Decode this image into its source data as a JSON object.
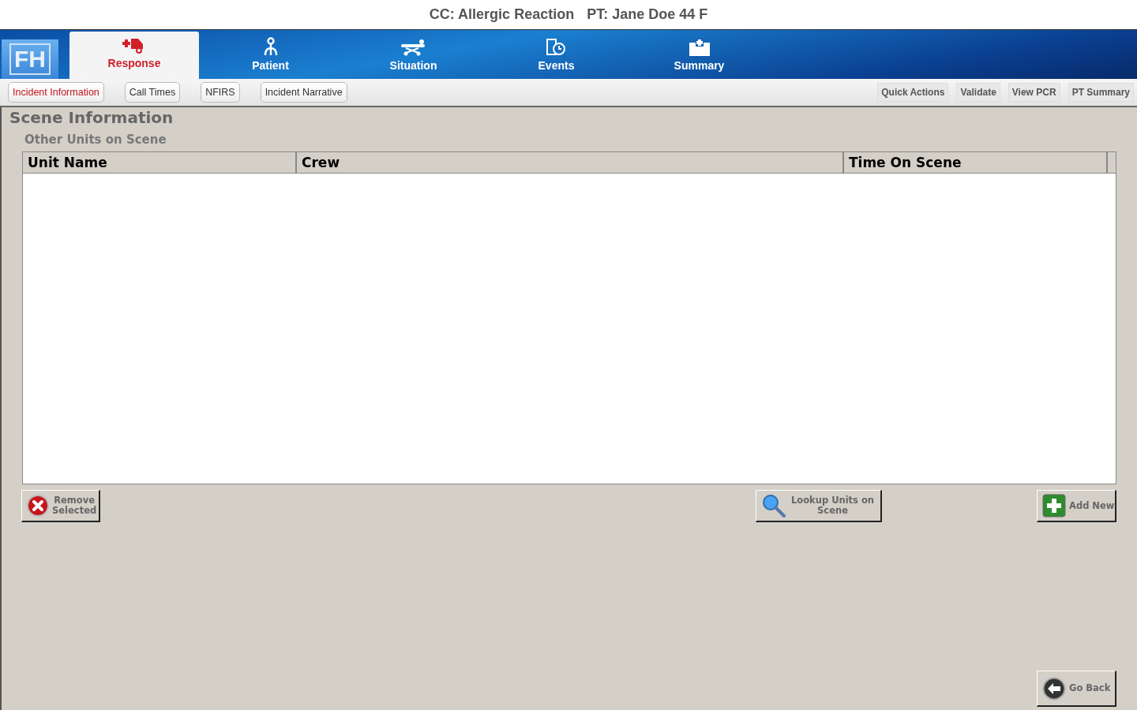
{
  "header": {
    "complaint": "CC: Allergic Reaction",
    "patient": "PT: Jane Doe 44 F"
  },
  "logo": "FH",
  "nav_tabs": [
    {
      "label": "Response",
      "kind": "ambulance",
      "selected": true
    },
    {
      "label": "Patient",
      "kind": "person",
      "selected": false
    },
    {
      "label": "Situation",
      "kind": "stretcher",
      "selected": false
    },
    {
      "label": "Events",
      "kind": "clock",
      "selected": false
    },
    {
      "label": "Summary",
      "kind": "hospital",
      "selected": false
    }
  ],
  "sub_tabs": [
    {
      "label": "Incident Information",
      "selected": true
    },
    {
      "label": "Call Times",
      "selected": false
    },
    {
      "label": "NFIRS",
      "selected": false
    },
    {
      "label": "Incident Narrative",
      "selected": false
    }
  ],
  "actions": [
    "Quick Actions",
    "Validate",
    "View PCR",
    "PT Summary"
  ],
  "section_title": "Scene Information",
  "subsection_title": "Other Units on Scene",
  "table": {
    "columns": [
      "Unit Name",
      "Crew",
      "Time On Scene"
    ]
  },
  "buttons": [
    {
      "label": "Remove Selected",
      "kind": "remove"
    },
    {
      "label": "Lookup Units on Scene",
      "kind": "search"
    },
    {
      "label": "Add New",
      "kind": "add"
    }
  ],
  "go_back": {
    "label": "Go Back"
  }
}
